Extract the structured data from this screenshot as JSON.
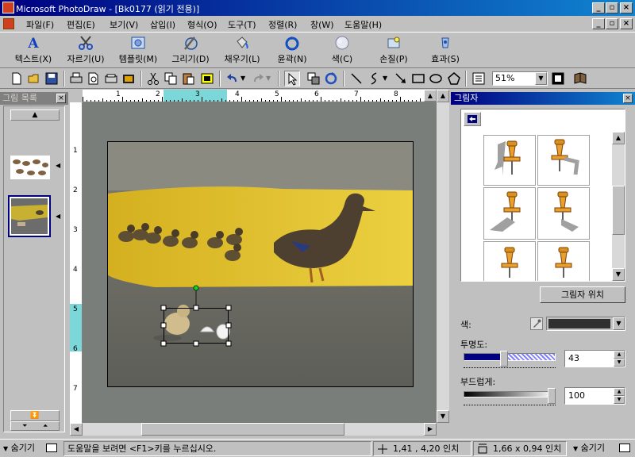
{
  "window": {
    "title": "Microsoft PhotoDraw - [Bk0177 (읽기 전용)]",
    "controls": [
      "_",
      "▫",
      "×"
    ],
    "doc_controls": [
      "_",
      "▫",
      "×"
    ]
  },
  "menu": [
    "파일(F)",
    "편집(E)",
    "보기(V)",
    "삽입(I)",
    "형식(O)",
    "도구(T)",
    "정렬(R)",
    "창(W)",
    "도움말(H)"
  ],
  "visual_toolbar": [
    "텍스트(X)",
    "자르기(U)",
    "템플릿(M)",
    "그리기(D)",
    "채우기(L)",
    "윤곽(N)",
    "색(C)",
    "손질(P)",
    "효과(S)"
  ],
  "zoom": "51%",
  "left_panel": {
    "title": "그림 목록",
    "close": "×"
  },
  "right_panel": {
    "title": "그림자",
    "close": "×",
    "shadow_position_button": "그림자 위치",
    "color_label": "색:",
    "transparency_label": "투명도:",
    "transparency_value": "43",
    "transparency_fraction": 0.43,
    "softness_label": "부드럽게:",
    "softness_value": "100",
    "softness_fraction": 1.0
  },
  "ruler": {
    "h_numbers": [
      "1",
      "2",
      "3",
      "4",
      "5",
      "6",
      "7",
      "8"
    ],
    "v_numbers": [
      "1",
      "2",
      "3",
      "4",
      "5",
      "6",
      "7"
    ]
  },
  "statusbar": {
    "hide_left": "숨기기",
    "help": "도움말을 보려면 <F1>키를 누르십시오.",
    "position": "1,41 , 4,20 인치",
    "size": "1,66 x 0,94 인치",
    "hide_right": "숨기기"
  }
}
